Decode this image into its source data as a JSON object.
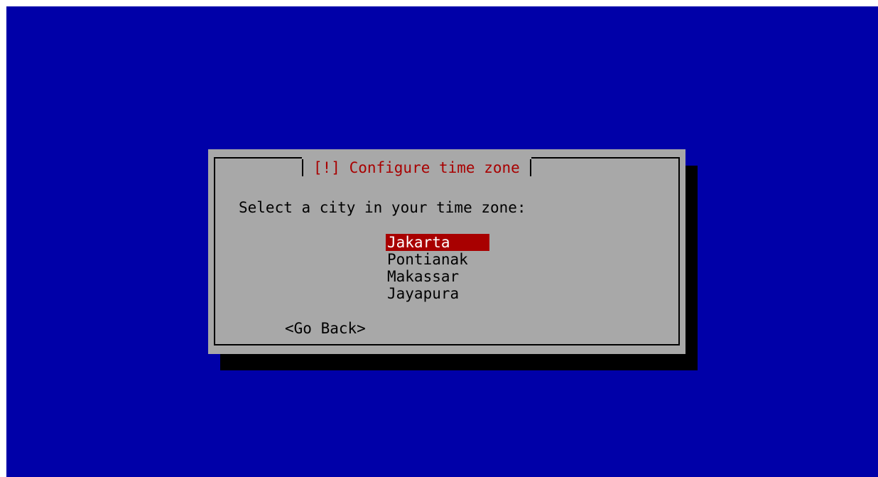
{
  "dialog": {
    "title": "[!] Configure time zone",
    "prompt": "Select a city in your time zone:",
    "cities": [
      {
        "label": "Jakarta",
        "selected": true
      },
      {
        "label": "Pontianak",
        "selected": false
      },
      {
        "label": "Makassar",
        "selected": false
      },
      {
        "label": "Jayapura",
        "selected": false
      }
    ],
    "go_back_label": "<Go Back>"
  },
  "colors": {
    "background": "#0000a8",
    "dialog": "#a8a8a8",
    "title": "#a80000",
    "selection": "#a80000",
    "shadow": "#000000"
  }
}
